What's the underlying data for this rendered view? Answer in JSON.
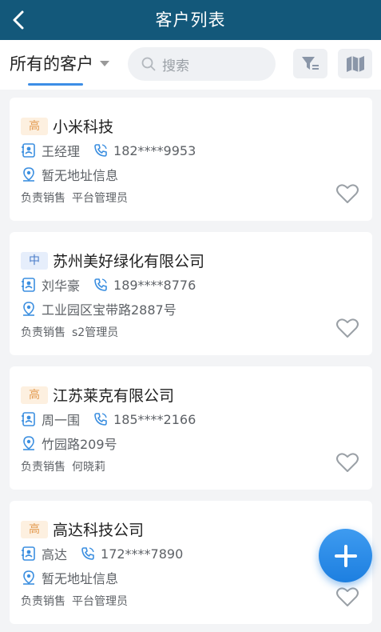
{
  "header": {
    "title": "客户列表"
  },
  "toolbar": {
    "scope_label": "所有的客户",
    "search_placeholder": "搜索"
  },
  "customers": [
    {
      "level": "高",
      "level_type": "high",
      "name": "小米科技",
      "contact": "王经理",
      "phone": "182****9953",
      "address": "暂无地址信息",
      "sales_label": "负责销售",
      "sales": "平台管理员"
    },
    {
      "level": "中",
      "level_type": "mid",
      "name": "苏州美好绿化有限公司",
      "contact": "刘华豪",
      "phone": "189****8776",
      "address": "工业园区宝带路2887号",
      "sales_label": "负责销售",
      "sales": "s2管理员"
    },
    {
      "level": "高",
      "level_type": "high",
      "name": "江苏莱克有限公司",
      "contact": "周一围",
      "phone": "185****2166",
      "address": "竹园路209号",
      "sales_label": "负责销售",
      "sales": "何晓莉"
    },
    {
      "level": "高",
      "level_type": "high",
      "name": "高达科技公司",
      "contact": "高达",
      "phone": "172****7890",
      "address": "暂无地址信息",
      "sales_label": "负责销售",
      "sales": "平台管理员"
    }
  ],
  "colors": {
    "navbar": "#13587a",
    "accent": "#3d8ee6",
    "level_high": "#e39a4f",
    "level_mid": "#4a7cc9",
    "fab": "#2a8ce8"
  },
  "icons": {
    "back": "chevron-left-icon",
    "search": "search-icon",
    "filter": "filter-icon",
    "map": "map-icon",
    "contact": "contact-card-icon",
    "phone": "phone-icon",
    "location": "location-pin-icon",
    "favorite": "heart-icon",
    "add": "plus-icon"
  }
}
